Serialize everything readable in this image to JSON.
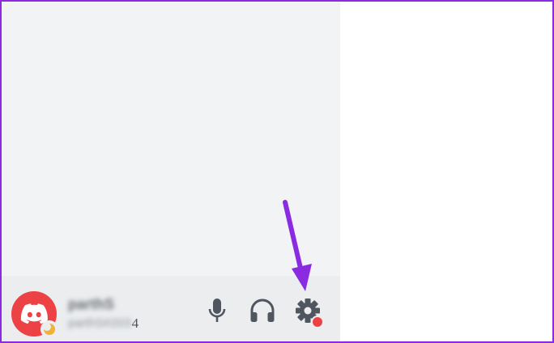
{
  "user_panel": {
    "username": "parthS",
    "usertag_blurred": "parthS#203",
    "usertag_visible_tail": "4",
    "avatar_icon": "discord-logo-icon",
    "status_icon": "idle-moon-icon"
  },
  "controls": {
    "mic_icon": "microphone-icon",
    "headset_icon": "headphones-icon",
    "settings_icon": "gear-icon",
    "settings_badge_icon": "red-dot-badge"
  },
  "annotation": {
    "arrow_icon": "arrow-down-icon",
    "arrow_color": "#8a2be2"
  },
  "colors": {
    "frame_border": "#8a2be2",
    "avatar_bg": "#ed4245",
    "icon_fill": "#4f5660",
    "status_idle": "#f0b232",
    "badge_red": "#ed4245"
  }
}
